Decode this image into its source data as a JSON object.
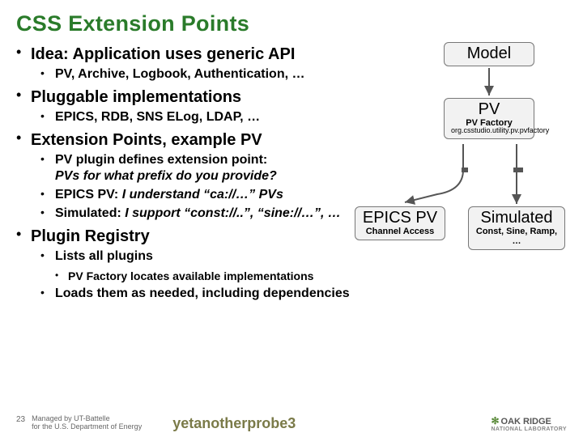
{
  "title": "CSS Extension Points",
  "bullets": {
    "idea": {
      "text": "Idea: Application uses generic API",
      "sub": "PV, Archive, Logbook, Authentication, …"
    },
    "pluggable": {
      "text": "Pluggable implementations",
      "sub": "EPICS, RDB, SNS ELog, LDAP, …"
    },
    "ext_points": {
      "text": "Extension Points, example PV",
      "sub_plugin_prefix": "PV plugin defines extension point:",
      "sub_plugin_line2": "PVs for what prefix do you provide?",
      "sub_epics_pv_prefix": "EPICS PV: ",
      "sub_epics_pv_it": "I understand “ca://…” PVs",
      "sub_sim_prefix": "Simulated: ",
      "sub_sim_it": "I support “const://..”, “sine://…”, …"
    },
    "registry": {
      "text": "Plugin Registry",
      "sub_lists": "Lists all plugins",
      "sub_factory": "PV Factory locates available implementations",
      "sub_loads": "Loads them as needed, including dependencies"
    }
  },
  "diagram": {
    "model": {
      "main": "Model"
    },
    "pv": {
      "main": "PV",
      "sub1": "PV Factory",
      "sub2": "org.csstudio.utility.pv.pvfactory"
    },
    "epics": {
      "main": "EPICS PV",
      "sub1": "Channel Access"
    },
    "sim": {
      "main": "Simulated",
      "sub1": "Const, Sine, Ramp, …"
    }
  },
  "footer": {
    "slide_no": "23",
    "managed1": "Managed by UT-Battelle",
    "managed2": "for the U.S. Department of Energy",
    "probe": "yetanotherprobe3",
    "logo_main": "OAK RIDGE",
    "logo_sub": "NATIONAL LABORATORY"
  }
}
